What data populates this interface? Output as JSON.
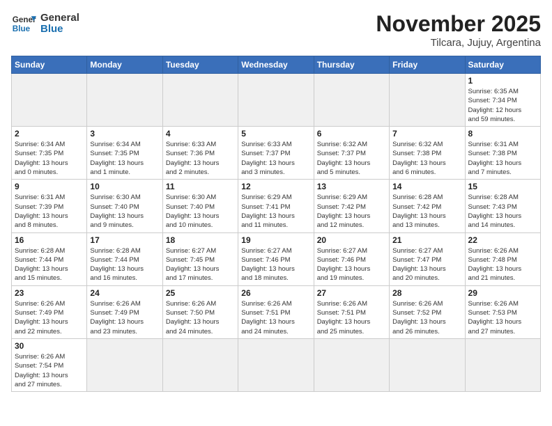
{
  "header": {
    "logo_general": "General",
    "logo_blue": "Blue",
    "title": "November 2025",
    "subtitle": "Tilcara, Jujuy, Argentina"
  },
  "weekdays": [
    "Sunday",
    "Monday",
    "Tuesday",
    "Wednesday",
    "Thursday",
    "Friday",
    "Saturday"
  ],
  "weeks": [
    [
      {
        "day": "",
        "info": ""
      },
      {
        "day": "",
        "info": ""
      },
      {
        "day": "",
        "info": ""
      },
      {
        "day": "",
        "info": ""
      },
      {
        "day": "",
        "info": ""
      },
      {
        "day": "",
        "info": ""
      },
      {
        "day": "1",
        "info": "Sunrise: 6:35 AM\nSunset: 7:34 PM\nDaylight: 12 hours\nand 59 minutes."
      }
    ],
    [
      {
        "day": "2",
        "info": "Sunrise: 6:34 AM\nSunset: 7:35 PM\nDaylight: 13 hours\nand 0 minutes."
      },
      {
        "day": "3",
        "info": "Sunrise: 6:34 AM\nSunset: 7:35 PM\nDaylight: 13 hours\nand 1 minute."
      },
      {
        "day": "4",
        "info": "Sunrise: 6:33 AM\nSunset: 7:36 PM\nDaylight: 13 hours\nand 2 minutes."
      },
      {
        "day": "5",
        "info": "Sunrise: 6:33 AM\nSunset: 7:37 PM\nDaylight: 13 hours\nand 3 minutes."
      },
      {
        "day": "6",
        "info": "Sunrise: 6:32 AM\nSunset: 7:37 PM\nDaylight: 13 hours\nand 5 minutes."
      },
      {
        "day": "7",
        "info": "Sunrise: 6:32 AM\nSunset: 7:38 PM\nDaylight: 13 hours\nand 6 minutes."
      },
      {
        "day": "8",
        "info": "Sunrise: 6:31 AM\nSunset: 7:38 PM\nDaylight: 13 hours\nand 7 minutes."
      }
    ],
    [
      {
        "day": "9",
        "info": "Sunrise: 6:31 AM\nSunset: 7:39 PM\nDaylight: 13 hours\nand 8 minutes."
      },
      {
        "day": "10",
        "info": "Sunrise: 6:30 AM\nSunset: 7:40 PM\nDaylight: 13 hours\nand 9 minutes."
      },
      {
        "day": "11",
        "info": "Sunrise: 6:30 AM\nSunset: 7:40 PM\nDaylight: 13 hours\nand 10 minutes."
      },
      {
        "day": "12",
        "info": "Sunrise: 6:29 AM\nSunset: 7:41 PM\nDaylight: 13 hours\nand 11 minutes."
      },
      {
        "day": "13",
        "info": "Sunrise: 6:29 AM\nSunset: 7:42 PM\nDaylight: 13 hours\nand 12 minutes."
      },
      {
        "day": "14",
        "info": "Sunrise: 6:28 AM\nSunset: 7:42 PM\nDaylight: 13 hours\nand 13 minutes."
      },
      {
        "day": "15",
        "info": "Sunrise: 6:28 AM\nSunset: 7:43 PM\nDaylight: 13 hours\nand 14 minutes."
      }
    ],
    [
      {
        "day": "16",
        "info": "Sunrise: 6:28 AM\nSunset: 7:44 PM\nDaylight: 13 hours\nand 15 minutes."
      },
      {
        "day": "17",
        "info": "Sunrise: 6:28 AM\nSunset: 7:44 PM\nDaylight: 13 hours\nand 16 minutes."
      },
      {
        "day": "18",
        "info": "Sunrise: 6:27 AM\nSunset: 7:45 PM\nDaylight: 13 hours\nand 17 minutes."
      },
      {
        "day": "19",
        "info": "Sunrise: 6:27 AM\nSunset: 7:46 PM\nDaylight: 13 hours\nand 18 minutes."
      },
      {
        "day": "20",
        "info": "Sunrise: 6:27 AM\nSunset: 7:46 PM\nDaylight: 13 hours\nand 19 minutes."
      },
      {
        "day": "21",
        "info": "Sunrise: 6:27 AM\nSunset: 7:47 PM\nDaylight: 13 hours\nand 20 minutes."
      },
      {
        "day": "22",
        "info": "Sunrise: 6:26 AM\nSunset: 7:48 PM\nDaylight: 13 hours\nand 21 minutes."
      }
    ],
    [
      {
        "day": "23",
        "info": "Sunrise: 6:26 AM\nSunset: 7:49 PM\nDaylight: 13 hours\nand 22 minutes."
      },
      {
        "day": "24",
        "info": "Sunrise: 6:26 AM\nSunset: 7:49 PM\nDaylight: 13 hours\nand 23 minutes."
      },
      {
        "day": "25",
        "info": "Sunrise: 6:26 AM\nSunset: 7:50 PM\nDaylight: 13 hours\nand 24 minutes."
      },
      {
        "day": "26",
        "info": "Sunrise: 6:26 AM\nSunset: 7:51 PM\nDaylight: 13 hours\nand 24 minutes."
      },
      {
        "day": "27",
        "info": "Sunrise: 6:26 AM\nSunset: 7:51 PM\nDaylight: 13 hours\nand 25 minutes."
      },
      {
        "day": "28",
        "info": "Sunrise: 6:26 AM\nSunset: 7:52 PM\nDaylight: 13 hours\nand 26 minutes."
      },
      {
        "day": "29",
        "info": "Sunrise: 6:26 AM\nSunset: 7:53 PM\nDaylight: 13 hours\nand 27 minutes."
      }
    ],
    [
      {
        "day": "30",
        "info": "Sunrise: 6:26 AM\nSunset: 7:54 PM\nDaylight: 13 hours\nand 27 minutes."
      },
      {
        "day": "",
        "info": ""
      },
      {
        "day": "",
        "info": ""
      },
      {
        "day": "",
        "info": ""
      },
      {
        "day": "",
        "info": ""
      },
      {
        "day": "",
        "info": ""
      },
      {
        "day": "",
        "info": ""
      }
    ]
  ]
}
